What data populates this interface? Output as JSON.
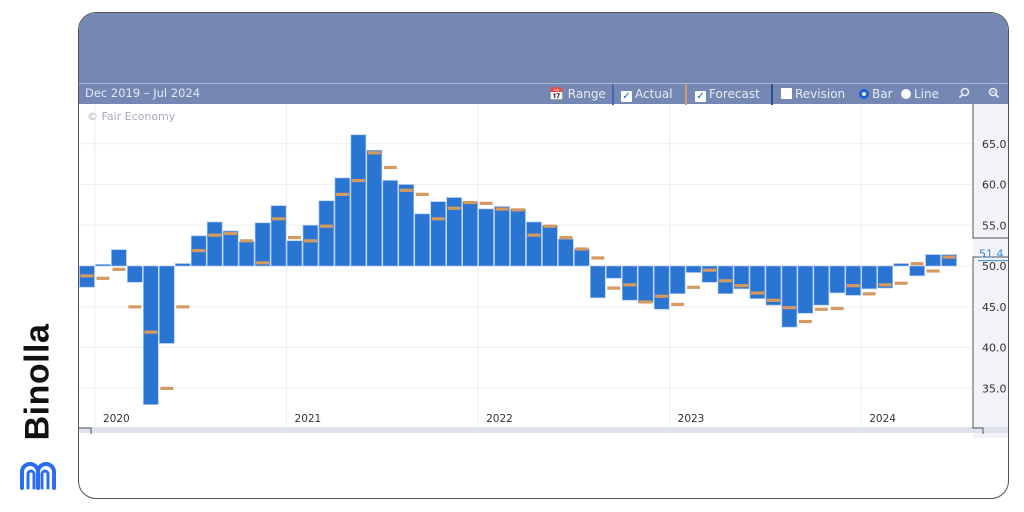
{
  "brand": {
    "name": "Binolla",
    "logo_icon": "binolla-logo-icon",
    "logo_color": "#2b6cf0"
  },
  "header": {
    "title": ""
  },
  "toolbar": {
    "date_range": "Dec 2019 – Jul 2024",
    "range_label": "Range",
    "actual_label": "Actual",
    "actual_checked": true,
    "forecast_label": "Forecast",
    "forecast_checked": true,
    "revision_label": "Revision",
    "revision_checked": false,
    "bar_label": "Bar",
    "line_label": "Line",
    "chart_mode": "Bar",
    "zoom_in_icon": "magnifier-icon",
    "zoom_out_icon": "zoom-out-icon"
  },
  "watermark": "© Fair Economy",
  "colors": {
    "actual": "#2a74d2",
    "forecast": "#d59a62",
    "header": "#7588b4",
    "latest_label": "#3a86e0"
  },
  "chart_data": {
    "type": "bar",
    "title": "",
    "xlabel": "",
    "ylabel": "",
    "baseline": 50.0,
    "ylim": [
      30.0,
      67.5
    ],
    "yticks": [
      35.0,
      40.0,
      45.0,
      50.0,
      55.0,
      60.0,
      65.0
    ],
    "ytick_labels": [
      "35.0",
      "40.0",
      "45.0",
      "50.0",
      "55.0",
      "60.0",
      "65.0"
    ],
    "xtick_labels": [
      "2020",
      "2021",
      "2022",
      "2023",
      "2024"
    ],
    "xtick_months": [
      "Jan 2020",
      "Jan 2021",
      "Jan 2022",
      "Jan 2023",
      "Jan 2024"
    ],
    "latest_value_label": "51.4",
    "grid": true,
    "legend": [
      "Actual",
      "Forecast"
    ],
    "categories": [
      "Dec 2019",
      "Jan 2020",
      "Feb 2020",
      "Mar 2020",
      "Apr 2020",
      "May 2020",
      "Jun 2020",
      "Jul 2020",
      "Aug 2020",
      "Sep 2020",
      "Oct 2020",
      "Nov 2020",
      "Dec 2020",
      "Jan 2021",
      "Feb 2021",
      "Mar 2021",
      "Apr 2021",
      "May 2021",
      "Jun 2021",
      "Jul 2021",
      "Aug 2021",
      "Sep 2021",
      "Oct 2021",
      "Nov 2021",
      "Dec 2021",
      "Jan 2022",
      "Feb 2022",
      "Mar 2022",
      "Apr 2022",
      "May 2022",
      "Jun 2022",
      "Jul 2022",
      "Aug 2022",
      "Sep 2022",
      "Oct 2022",
      "Nov 2022",
      "Dec 2022",
      "Jan 2023",
      "Feb 2023",
      "Mar 2023",
      "Apr 2023",
      "May 2023",
      "Jun 2023",
      "Jul 2023",
      "Aug 2023",
      "Sep 2023",
      "Oct 2023",
      "Nov 2023",
      "Dec 2023",
      "Jan 2024",
      "Feb 2024",
      "Mar 2024",
      "Apr 2024",
      "May 2024",
      "Jun 2024"
    ],
    "series": [
      {
        "name": "Actual",
        "values": [
          47.4,
          50.2,
          52.0,
          48.0,
          33.0,
          40.5,
          50.3,
          53.7,
          55.4,
          54.3,
          53.0,
          55.3,
          57.4,
          53.1,
          55.0,
          58.0,
          60.8,
          66.1,
          64.2,
          60.5,
          60.0,
          56.4,
          57.9,
          58.4,
          57.9,
          57.0,
          57.3,
          57.0,
          55.4,
          55.0,
          53.3,
          52.1,
          46.1,
          48.5,
          45.8,
          45.5,
          44.7,
          46.6,
          49.2,
          48.0,
          46.6,
          47.2,
          46.0,
          45.2,
          42.5,
          44.2,
          45.2,
          46.7,
          46.4,
          47.2,
          47.3,
          50.3,
          48.8,
          51.4,
          51.4
        ]
      },
      {
        "name": "Forecast",
        "values": [
          48.8,
          48.5,
          49.6,
          45.0,
          41.9,
          35.0,
          45.0,
          51.9,
          53.8,
          54.0,
          53.1,
          50.4,
          55.8,
          53.5,
          53.1,
          54.9,
          58.8,
          60.5,
          63.9,
          62.1,
          59.3,
          58.8,
          55.8,
          57.1,
          57.8,
          57.7,
          57.0,
          56.9,
          53.8,
          54.9,
          53.5,
          52.1,
          51.0,
          47.3,
          47.7,
          45.6,
          46.3,
          45.3,
          47.4,
          49.5,
          48.2,
          47.6,
          46.7,
          45.8,
          44.9,
          43.2,
          44.7,
          44.8,
          47.6,
          46.6,
          47.7,
          47.9,
          50.3,
          49.4,
          51.1
        ]
      }
    ]
  }
}
